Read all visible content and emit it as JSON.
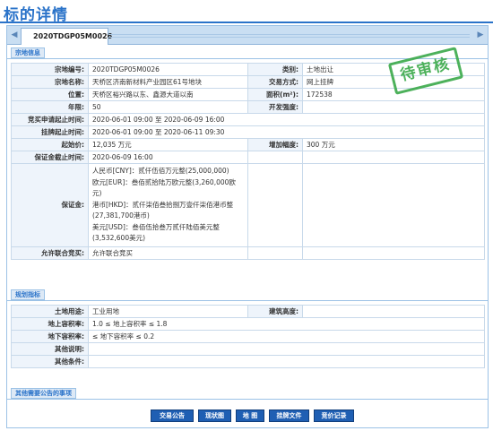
{
  "page": {
    "title": "标的详情"
  },
  "tab": {
    "label": "2020TDGP05M0026"
  },
  "stamp": {
    "text": "待审核",
    "color": "#3eab4e"
  },
  "colors": {
    "accent": "#2a73c9",
    "button": "#1f5fb3"
  },
  "icons": {
    "tab_left": "chevron-left-icon",
    "tab_right": "chevron-right-icon"
  },
  "sections": {
    "parcel": "宗地信息",
    "planning": "规划指标",
    "other": "其他需要公告的事项"
  },
  "parcel": {
    "code_label": "宗地编号:",
    "code_value": "2020TDGP05M0026",
    "category_label": "类别:",
    "category_value": "土地出让",
    "name_label": "宗地名称:",
    "name_value": "天桥区济南新材料产业园区61号地块",
    "trade_label": "交易方式:",
    "trade_value": "网上挂牌",
    "location_label": "位置:",
    "location_value": "天桥区裕兴路以东、鑫源大道以南",
    "area_label": "面积(m²):",
    "area_value": "172538",
    "years_label": "年限:",
    "years_value": "50",
    "intensity_label": "开发强度:",
    "intensity_value": "",
    "apply_label": "竞买申请起止时间:",
    "apply_value": "2020-06-01 09:00 至 2020-06-09 16:00",
    "listing_label": "挂牌起止时间:",
    "listing_value": "2020-06-01 09:00 至 2020-06-11 09:30",
    "start_price_label": "起始价:",
    "start_price_value": "12,035 万元",
    "increment_label": "增加幅度:",
    "increment_value": "300 万元",
    "deposit_deadline_label": "保证金截止时间:",
    "deposit_deadline_value": "2020-06-09 16:00",
    "deposit_label": "保证金:",
    "deposit_lines": [
      "人民币[CNY]：贰仟伍佰万元整(25,000,000)",
      "欧元[EUR]：叁佰贰拾陆万欧元整(3,260,000欧元)",
      "港币[HKD]：贰仟柒佰叁拾捌万壹仟柒佰港币整(27,381,700港币)",
      "美元[USD]：叁佰伍拾叁万贰仟陆佰美元整(3,532,600美元)"
    ],
    "joint_label": "允许联合竞买:",
    "joint_value": "允许联合竞买"
  },
  "planning": {
    "land_use_label": "土地用途:",
    "land_use_value": "工业用地",
    "height_label": "建筑高度:",
    "height_value": "",
    "above_ratio_label": "地上容积率:",
    "above_ratio_value": "1.0 ≤ 地上容积率 ≤ 1.8",
    "below_ratio_label": "地下容积率:",
    "below_ratio_value": "≤ 地下容积率 ≤ 0.2",
    "other_desc_label": "其他说明:",
    "other_desc_value": "",
    "other_cond_label": "其他条件:",
    "other_cond_value": ""
  },
  "buttons": {
    "announcement": "交易公告",
    "status_map": "现状图",
    "map": "地 图",
    "listing_docs": "挂牌文件",
    "bid_records": "竞价记录"
  }
}
